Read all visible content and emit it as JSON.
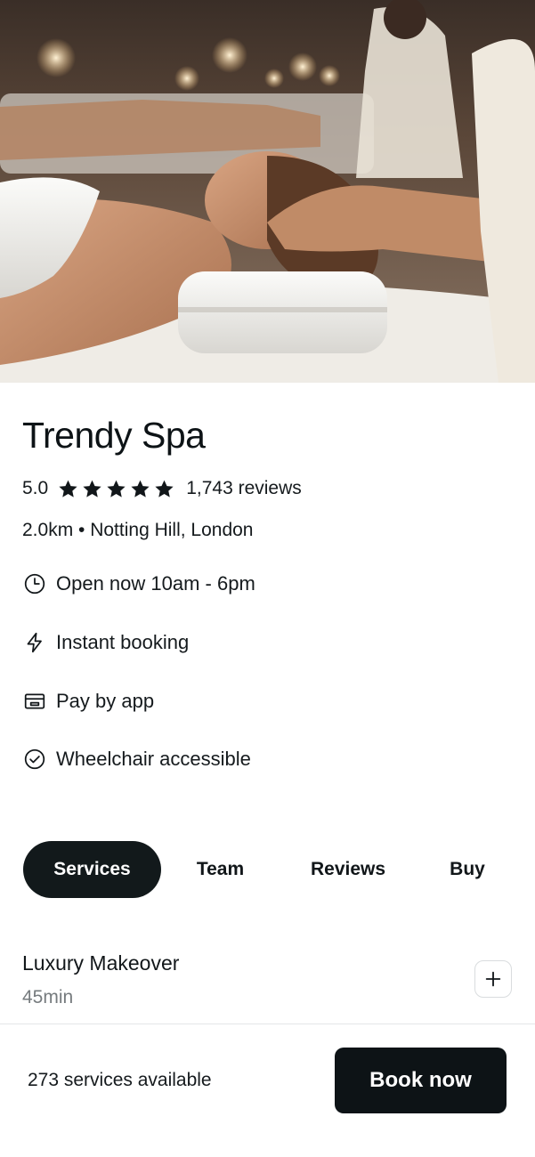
{
  "hero": {
    "image": "spa-massage-photo"
  },
  "venue": {
    "name": "Trendy Spa",
    "rating": "5.0",
    "rating_value": 5,
    "rating_max": 5,
    "reviews": "1,743 reviews",
    "location": "2.0km • Notting Hill, London"
  },
  "features": [
    {
      "icon": "clock-icon",
      "label": "Open now 10am - 6pm"
    },
    {
      "icon": "lightning-icon",
      "label": "Instant booking"
    },
    {
      "icon": "wallet-icon",
      "label": "Pay by app"
    },
    {
      "icon": "check-circle-icon",
      "label": "Wheelchair accessible"
    }
  ],
  "tabs": [
    {
      "label": "Services",
      "active": true
    },
    {
      "label": "Team",
      "active": false
    },
    {
      "label": "Reviews",
      "active": false
    },
    {
      "label": "Buy",
      "active": false
    }
  ],
  "service": {
    "name": "Luxury Makeover",
    "duration": "45min"
  },
  "footer": {
    "count": "273 services available",
    "book_label": "Book now"
  },
  "colors": {
    "primary": "#0d1316",
    "text": "#151a1d",
    "muted": "#767b7e",
    "border": "#d9dcde"
  }
}
